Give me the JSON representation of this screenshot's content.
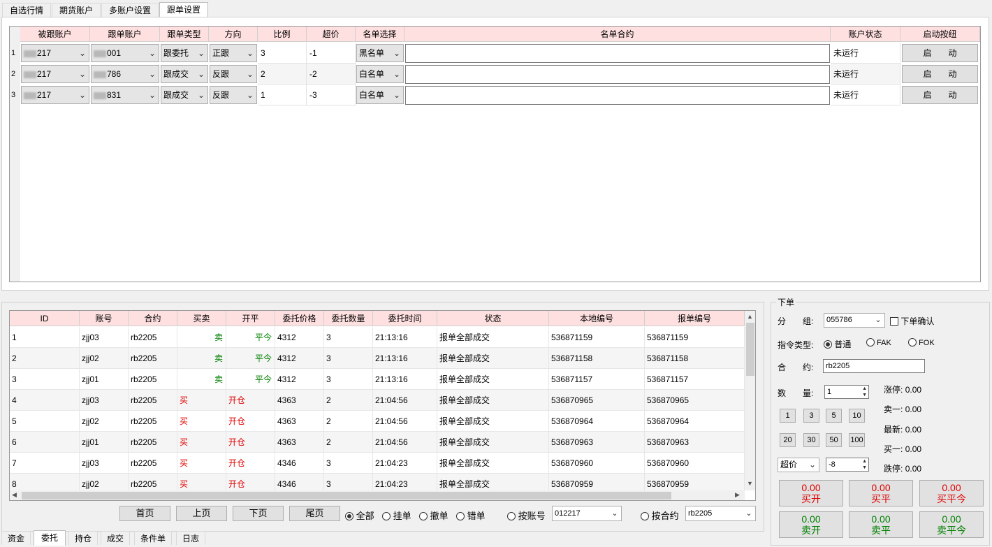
{
  "top_tabs": [
    "自选行情",
    "期货账户",
    "多账户设置",
    "跟单设置"
  ],
  "follow": {
    "headers": [
      "被跟账户",
      "跟单账户",
      "跟单类型",
      "方向",
      "比例",
      "超价",
      "名单选择",
      "名单合约",
      "账户状态",
      "启动按纽"
    ],
    "rows": [
      {
        "no": "1",
        "src": "217",
        "dst": "001",
        "type": "跟委托",
        "dir": "正跟",
        "ratio": "3",
        "over": "-1",
        "list": "黑名单",
        "contract": "",
        "status": "未运行",
        "btn": "启　　动"
      },
      {
        "no": "2",
        "src": "217",
        "dst": "786",
        "type": "跟成交",
        "dir": "反跟",
        "ratio": "2",
        "over": "-2",
        "list": "白名单",
        "contract": "",
        "status": "未运行",
        "btn": "启　　动"
      },
      {
        "no": "3",
        "src": "217",
        "dst": "831",
        "type": "跟成交",
        "dir": "反跟",
        "ratio": "1",
        "over": "-3",
        "list": "白名单",
        "contract": "",
        "status": "未运行",
        "btn": "启　　动"
      }
    ]
  },
  "orders": {
    "headers": [
      "ID",
      "账号",
      "合约",
      "买卖",
      "开平",
      "委托价格",
      "委托数量",
      "委托时间",
      "状态",
      "本地编号",
      "报单编号"
    ],
    "rows": [
      {
        "id": "1",
        "acct": "zjj03",
        "inst": "rb2205",
        "side": "卖",
        "oc": "平今",
        "price": "4312",
        "qty": "3",
        "time": "21:13:16",
        "state": "报单全部成交",
        "local": "536871159",
        "sys": "536871159"
      },
      {
        "id": "2",
        "acct": "zjj02",
        "inst": "rb2205",
        "side": "卖",
        "oc": "平今",
        "price": "4312",
        "qty": "3",
        "time": "21:13:16",
        "state": "报单全部成交",
        "local": "536871158",
        "sys": "536871158"
      },
      {
        "id": "3",
        "acct": "zjj01",
        "inst": "rb2205",
        "side": "卖",
        "oc": "平今",
        "price": "4312",
        "qty": "3",
        "time": "21:13:16",
        "state": "报单全部成交",
        "local": "536871157",
        "sys": "536871157"
      },
      {
        "id": "4",
        "acct": "zjj03",
        "inst": "rb2205",
        "side": "买",
        "oc": "开仓",
        "price": "4363",
        "qty": "2",
        "time": "21:04:56",
        "state": "报单全部成交",
        "local": "536870965",
        "sys": "536870965"
      },
      {
        "id": "5",
        "acct": "zjj02",
        "inst": "rb2205",
        "side": "买",
        "oc": "开仓",
        "price": "4363",
        "qty": "2",
        "time": "21:04:56",
        "state": "报单全部成交",
        "local": "536870964",
        "sys": "536870964"
      },
      {
        "id": "6",
        "acct": "zjj01",
        "inst": "rb2205",
        "side": "买",
        "oc": "开仓",
        "price": "4363",
        "qty": "2",
        "time": "21:04:56",
        "state": "报单全部成交",
        "local": "536870963",
        "sys": "536870963"
      },
      {
        "id": "7",
        "acct": "zjj03",
        "inst": "rb2205",
        "side": "买",
        "oc": "开仓",
        "price": "4346",
        "qty": "3",
        "time": "21:04:23",
        "state": "报单全部成交",
        "local": "536870960",
        "sys": "536870960"
      },
      {
        "id": "8",
        "acct": "zjj02",
        "inst": "rb2205",
        "side": "买",
        "oc": "开仓",
        "price": "4346",
        "qty": "3",
        "time": "21:04:23",
        "state": "报单全部成交",
        "local": "536870959",
        "sys": "536870959"
      }
    ]
  },
  "pager": {
    "first": "首页",
    "prev": "上页",
    "next": "下页",
    "last": "尾页",
    "filters": [
      "全部",
      "挂单",
      "撤单",
      "错单"
    ],
    "by_account": "按账号",
    "account_value": "012217",
    "by_contract": "按合约",
    "contract_value": "rb2205"
  },
  "bottom_tabs": [
    "资金",
    "委托",
    "持仓",
    "成交",
    "条件单",
    "日志"
  ],
  "order_panel": {
    "title": "下单",
    "group_label": "分　　组:",
    "group_value": "055786",
    "confirm_label": "下单确认",
    "type_label": "指令类型:",
    "type_options": [
      "普通",
      "FAK",
      "FOK"
    ],
    "contract_label": "合　　约:",
    "contract_value": "rb2205",
    "qty_label": "数　　量:",
    "qty_value": "1",
    "quick_qty": [
      "1",
      "3",
      "5",
      "10",
      "20",
      "30",
      "50",
      "100"
    ],
    "price_mode": "超价",
    "price_offset": "-8",
    "quotes": [
      {
        "label": "涨停:",
        "value": "0.00"
      },
      {
        "label": "卖一:",
        "value": "0.00"
      },
      {
        "label": "最新:",
        "value": "0.00"
      },
      {
        "label": "买一:",
        "value": "0.00"
      },
      {
        "label": "跌停:",
        "value": "0.00"
      }
    ],
    "buttons": [
      {
        "price": "0.00",
        "label": "买开"
      },
      {
        "price": "0.00",
        "label": "买平"
      },
      {
        "price": "0.00",
        "label": "买平今"
      },
      {
        "price": "0.00",
        "label": "卖开"
      },
      {
        "price": "0.00",
        "label": "卖平"
      },
      {
        "price": "0.00",
        "label": "卖平今"
      }
    ]
  }
}
